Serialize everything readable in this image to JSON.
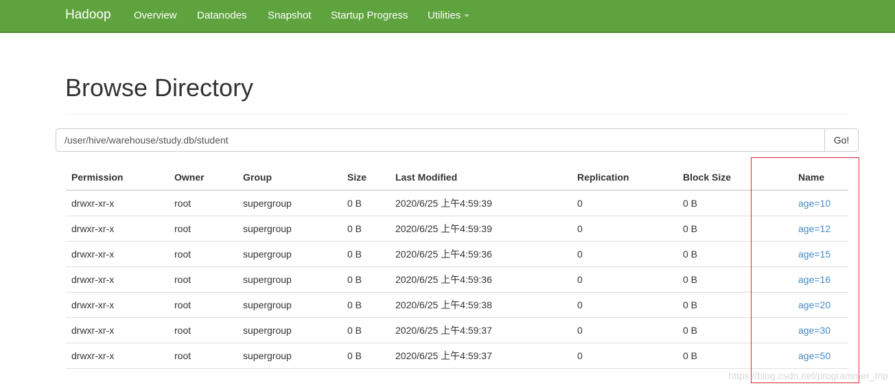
{
  "nav": {
    "brand": "Hadoop",
    "links": [
      "Overview",
      "Datanodes",
      "Snapshot",
      "Startup Progress",
      "Utilities"
    ]
  },
  "page": {
    "title": "Browse Directory"
  },
  "path": {
    "value": "/user/hive/warehouse/study.db/student",
    "go_label": "Go!"
  },
  "table": {
    "headers": [
      "Permission",
      "Owner",
      "Group",
      "Size",
      "Last Modified",
      "Replication",
      "Block Size",
      "Name"
    ],
    "rows": [
      [
        "drwxr-xr-x",
        "root",
        "supergroup",
        "0 B",
        "2020/6/25 上午4:59:39",
        "0",
        "0 B",
        "age=10"
      ],
      [
        "drwxr-xr-x",
        "root",
        "supergroup",
        "0 B",
        "2020/6/25 上午4:59:39",
        "0",
        "0 B",
        "age=12"
      ],
      [
        "drwxr-xr-x",
        "root",
        "supergroup",
        "0 B",
        "2020/6/25 上午4:59:36",
        "0",
        "0 B",
        "age=15"
      ],
      [
        "drwxr-xr-x",
        "root",
        "supergroup",
        "0 B",
        "2020/6/25 上午4:59:36",
        "0",
        "0 B",
        "age=16"
      ],
      [
        "drwxr-xr-x",
        "root",
        "supergroup",
        "0 B",
        "2020/6/25 上午4:59:38",
        "0",
        "0 B",
        "age=20"
      ],
      [
        "drwxr-xr-x",
        "root",
        "supergroup",
        "0 B",
        "2020/6/25 上午4:59:37",
        "0",
        "0 B",
        "age=30"
      ],
      [
        "drwxr-xr-x",
        "root",
        "supergroup",
        "0 B",
        "2020/6/25 上午4:59:37",
        "0",
        "0 B",
        "age=50"
      ]
    ]
  },
  "watermark": "https://blog.csdn.net/programmer_trip",
  "colors": {
    "navbar": "#5fa33e",
    "link": "#428bca",
    "highlight": "#e0262a"
  }
}
